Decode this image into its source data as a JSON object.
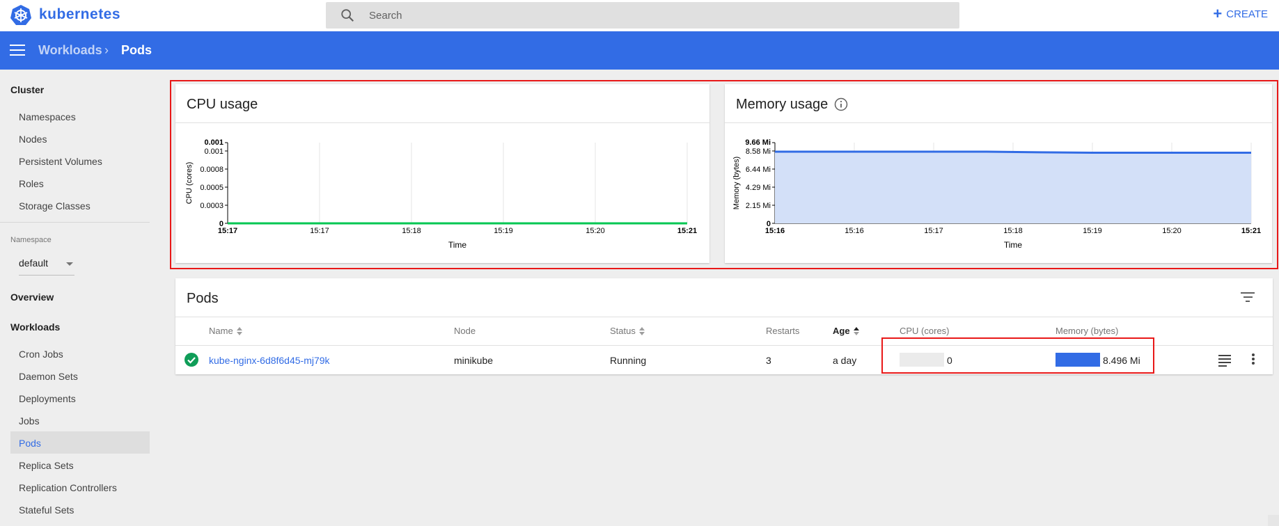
{
  "app": {
    "brand": "kubernetes"
  },
  "search": {
    "placeholder": "Search",
    "value": ""
  },
  "header": {
    "create_label": "CREATE"
  },
  "breadcrumb": {
    "parent": "Workloads",
    "separator": "›",
    "current": "Pods"
  },
  "sidebar": {
    "cluster_heading": "Cluster",
    "cluster_items": [
      "Namespaces",
      "Nodes",
      "Persistent Volumes",
      "Roles",
      "Storage Classes"
    ],
    "namespace_label": "Namespace",
    "namespace_value": "default",
    "overview": "Overview",
    "workloads_heading": "Workloads",
    "workload_items": [
      "Cron Jobs",
      "Daemon Sets",
      "Deployments",
      "Jobs",
      "Pods",
      "Replica Sets",
      "Replication Controllers",
      "Stateful Sets"
    ],
    "active_item": "Pods"
  },
  "cpu_card": {
    "title": "CPU usage"
  },
  "memory_card": {
    "title": "Memory usage"
  },
  "chart_data": [
    {
      "type": "line",
      "title": "CPU usage",
      "xlabel": "Time",
      "ylabel": "CPU (cores)",
      "x_ticks": [
        "15:17",
        "15:17",
        "15:18",
        "15:19",
        "15:20",
        "15:21"
      ],
      "y_ticks": [
        "0",
        "0.0003",
        "0.0005",
        "0.0008",
        "0.001",
        "0.001"
      ],
      "ylim": [
        0,
        0.001
      ],
      "series": [
        {
          "values": [
            0,
            0,
            0,
            0,
            0,
            0
          ],
          "color": "#00c752"
        }
      ]
    },
    {
      "type": "area",
      "title": "Memory usage",
      "xlabel": "Time",
      "ylabel": "Memory (bytes)",
      "x_ticks": [
        "15:16",
        "15:16",
        "15:17",
        "15:18",
        "15:19",
        "15:20",
        "15:21"
      ],
      "y_ticks": [
        "0",
        "2.15 Mi",
        "4.29 Mi",
        "6.44 Mi",
        "8.58 Mi",
        "9.66 Mi"
      ],
      "ylim": [
        0,
        9.66
      ],
      "series": [
        {
          "values": [
            8.58,
            8.58,
            8.58,
            8.58,
            8.58,
            8.5,
            8.45,
            8.45,
            8.45,
            8.45
          ],
          "color": "#326ce5",
          "fill": "#d3e0f8"
        }
      ]
    }
  ],
  "pods": {
    "title": "Pods",
    "columns": {
      "name": "Name",
      "node": "Node",
      "status": "Status",
      "restarts": "Restarts",
      "age": "Age",
      "cpu": "CPU (cores)",
      "memory": "Memory (bytes)"
    },
    "rows": [
      {
        "name": "kube-nginx-6d8f6d45-mj79k",
        "node": "minikube",
        "status": "Running",
        "restarts": "3",
        "age": "a day",
        "cpu": "0",
        "cpu_fraction": 0,
        "memory": "8.496 Mi",
        "memory_fraction": 1
      }
    ]
  },
  "colors": {
    "accent": "#326ce5",
    "ok": "#0f9d58",
    "highlight_box": "#e81818"
  }
}
